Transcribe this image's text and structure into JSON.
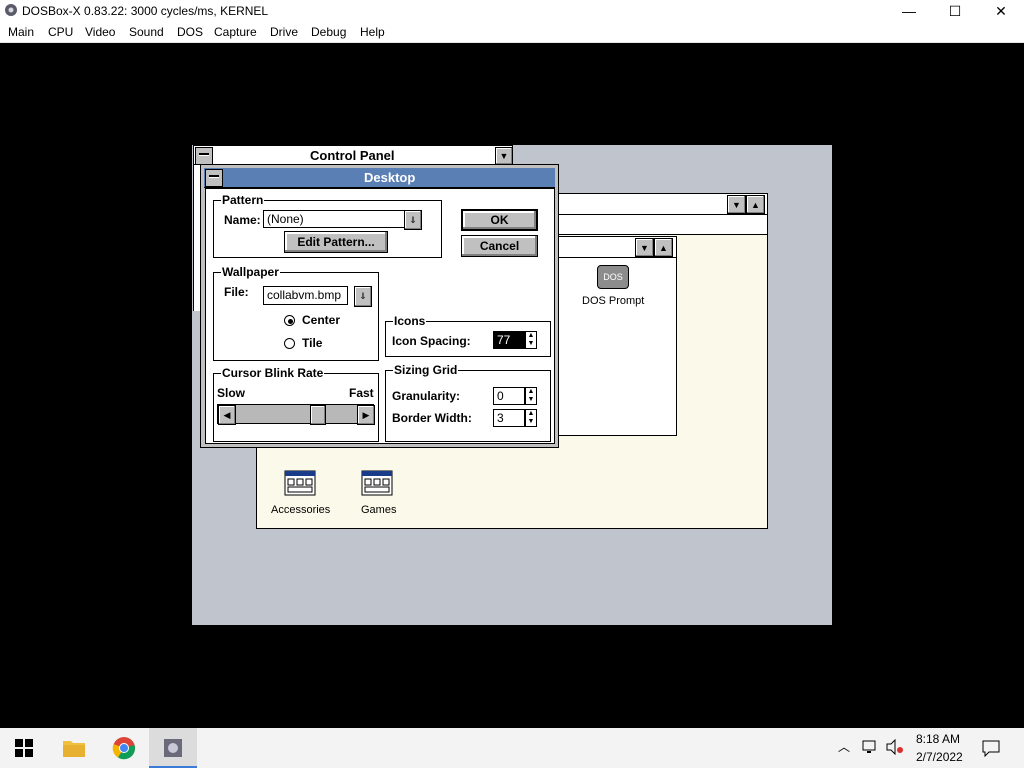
{
  "host": {
    "title": "DOSBox-X 0.83.22: 3000 cycles/ms, KERNEL",
    "controls": {
      "minimize": "—",
      "maximize": "☐",
      "close": "✕"
    },
    "menu": [
      "Main",
      "CPU",
      "Video",
      "Sound",
      "DOS",
      "Capture",
      "Drive",
      "Debug",
      "Help"
    ]
  },
  "control_panel": {
    "title": "Control Panel"
  },
  "program_group": {
    "icons": [
      {
        "label": "Accessories"
      },
      {
        "label": "Games"
      }
    ],
    "dos_icon": {
      "glyph": "DOS",
      "label": "DOS Prompt"
    }
  },
  "desktop_dialog": {
    "title": "Desktop",
    "pattern": {
      "label": "Pattern",
      "name_label": "Name:",
      "name_value": "(None)",
      "edit_button": "Edit Pattern..."
    },
    "ok_button": "OK",
    "cancel_button": "Cancel",
    "wallpaper": {
      "label": "Wallpaper",
      "file_label": "File:",
      "file_value": "collabvm.bmp",
      "center_label": "Center",
      "tile_label": "Tile",
      "selected": "Center"
    },
    "icons": {
      "label": "Icons",
      "spacing_label": "Icon Spacing:",
      "spacing_value": "77"
    },
    "cursor_blink": {
      "label": "Cursor Blink Rate",
      "slow_label": "Slow",
      "fast_label": "Fast",
      "level": 0.7
    },
    "sizing_grid": {
      "label": "Sizing Grid",
      "granularity_label": "Granularity:",
      "granularity_value": "0",
      "border_label": "Border Width:",
      "border_value": "3"
    }
  },
  "taskbar": {
    "time": "8:18 AM",
    "date": "2/7/2022",
    "icons": [
      "windows-start-icon",
      "file-explorer-icon",
      "chrome-icon",
      "dosbox-icon"
    ]
  }
}
